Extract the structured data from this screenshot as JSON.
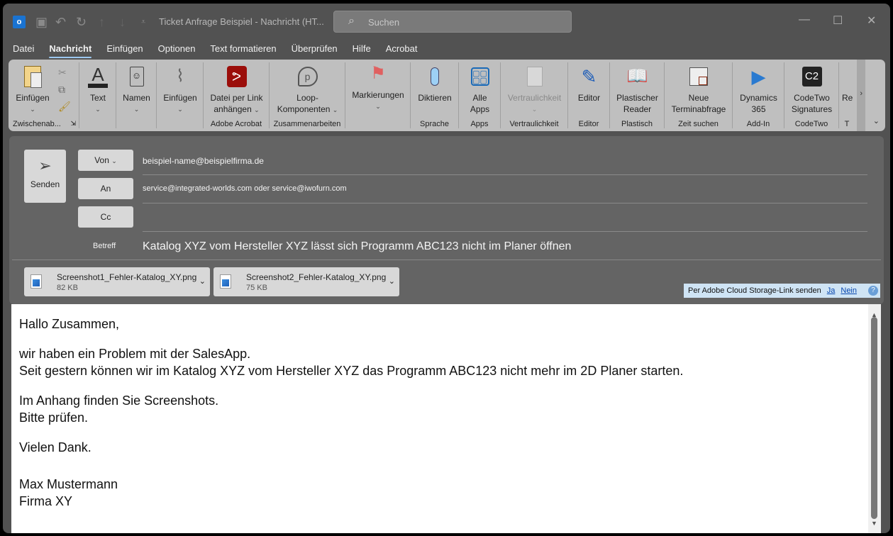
{
  "titlebar": {
    "title": "Ticket Anfrage Beispiel  -  Nachricht (HT...",
    "search_placeholder": "Suchen"
  },
  "menu": [
    "Datei",
    "Nachricht",
    "Einfügen",
    "Optionen",
    "Text formatieren",
    "Überprüfen",
    "Hilfe",
    "Acrobat"
  ],
  "menu_active": "Nachricht",
  "ribbon": {
    "einfuegen": "Einfügen",
    "zwischenablage": "Zwischenab...",
    "text": "Text",
    "namen": "Namen",
    "einfuegen2": "Einfügen",
    "datei_link_1": "Datei per Link",
    "datei_link_2": "anhängen",
    "adobe": "Adobe Acrobat",
    "loop_1": "Loop-",
    "loop_2": "Komponenten",
    "zusammen": "Zusammenarbeiten",
    "markierungen": "Markierungen",
    "diktieren": "Diktieren",
    "sprache": "Sprache",
    "apps_1": "Alle",
    "apps_2": "Apps",
    "apps": "Apps",
    "vertraulichkeit": "Vertraulichkeit",
    "vertraulichkeit_g": "Vertraulichkeit",
    "editor": "Editor",
    "editor_g": "Editor",
    "reader_1": "Plastischer",
    "reader_2": "Reader",
    "plastisch": "Plastisch",
    "termin_1": "Neue",
    "termin_2": "Terminabfrage",
    "zeit": "Zeit suchen",
    "dyn_1": "Dynamics",
    "dyn_2": "365",
    "addin": "Add-In",
    "c2_1": "CodeTwo",
    "c2_2": "Signatures",
    "codetwo": "CodeTwo",
    "c2_logo": "C2",
    "partial": "Re",
    "partial_g": "T"
  },
  "compose": {
    "send": "Senden",
    "from_label": "Von",
    "from": "beispiel-name@beispielfirma.de",
    "to_label": "An",
    "to": "service@integrated-worlds.com oder service@iwofurn.com",
    "cc_label": "Cc",
    "cc": "",
    "subject_label": "Betreff",
    "subject": "Katalog XYZ vom Hersteller XYZ lässt sich Programm ABC123 nicht im Planer öffnen",
    "attachments": [
      {
        "name": "Screenshot1_Fehler-Katalog_XY.png",
        "size": "82 KB"
      },
      {
        "name": "Screenshot2_Fehler-Katalog_XY.png",
        "size": "75 KB"
      }
    ],
    "cloud_text": "Per Adobe Cloud Storage-Link senden",
    "cloud_yes": "Ja",
    "cloud_no": "Nein"
  },
  "body": [
    "Hallo Zusammen,",
    "wir haben ein Problem mit der SalesApp.",
    "Seit gestern können wir im Katalog XYZ vom Hersteller XYZ das Programm ABC123 nicht mehr im 2D Planer starten.",
    "Im Anhang finden Sie Screenshots.",
    "Bitte prüfen.",
    "Vielen Dank.",
    "Max Mustermann",
    "Firma XY"
  ]
}
